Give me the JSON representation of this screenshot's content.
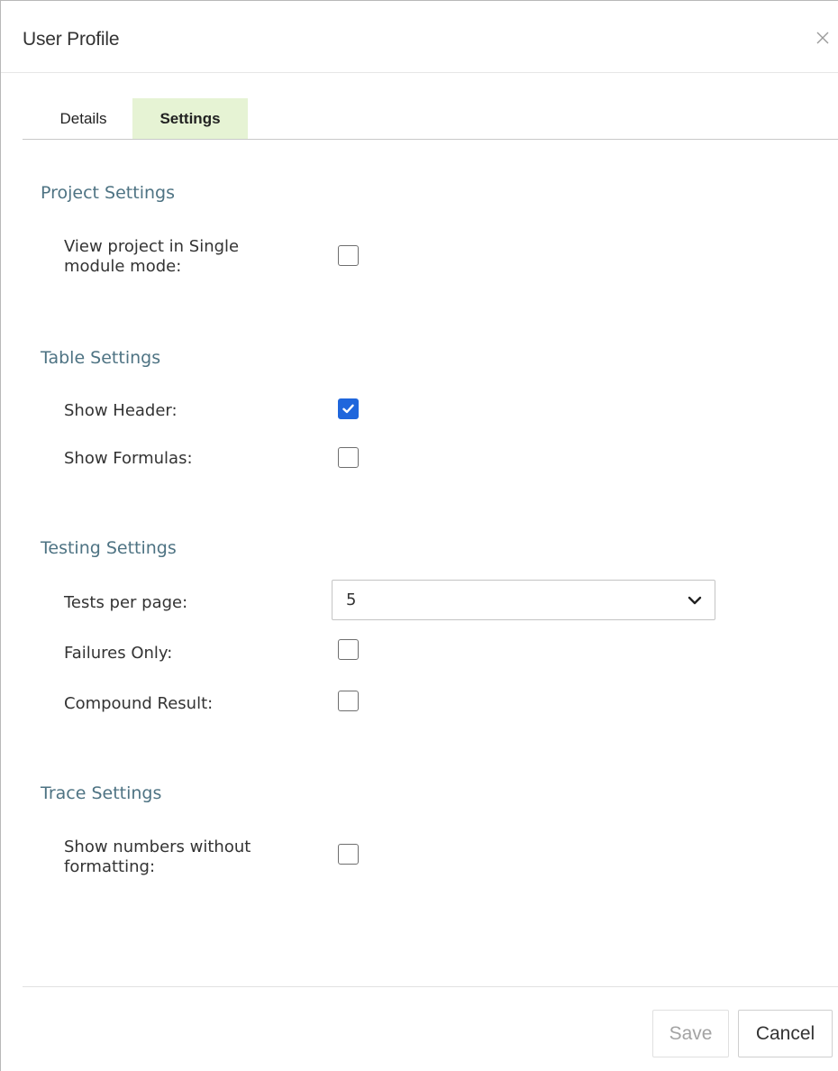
{
  "dialog": {
    "title": "User Profile",
    "close_icon": "close-icon"
  },
  "tabs": [
    {
      "label": "Details",
      "active": false
    },
    {
      "label": "Settings",
      "active": true
    }
  ],
  "colors": {
    "active_tab_bg": "#e6f3d4",
    "section_title": "#4e7383",
    "checkbox_checked": "#1f66dc"
  },
  "project_settings": {
    "title": "Project Settings",
    "single_module_label": "View project in Single\nmodule mode:",
    "single_module_checked": false
  },
  "table_settings": {
    "title": "Table Settings",
    "show_header_label": "Show Header:",
    "show_header_checked": true,
    "show_formulas_label": "Show Formulas:",
    "show_formulas_checked": false
  },
  "testing_settings": {
    "title": "Testing Settings",
    "tests_per_page_label": "Tests per page:",
    "tests_per_page_value": "5",
    "failures_only_label": "Failures Only:",
    "failures_only_checked": false,
    "compound_result_label": "Compound Result:",
    "compound_result_checked": false
  },
  "trace_settings": {
    "title": "Trace Settings",
    "numbers_label": "Show numbers without\nformatting:",
    "numbers_checked": false
  },
  "footer": {
    "save_label": "Save",
    "save_enabled": false,
    "cancel_label": "Cancel"
  }
}
